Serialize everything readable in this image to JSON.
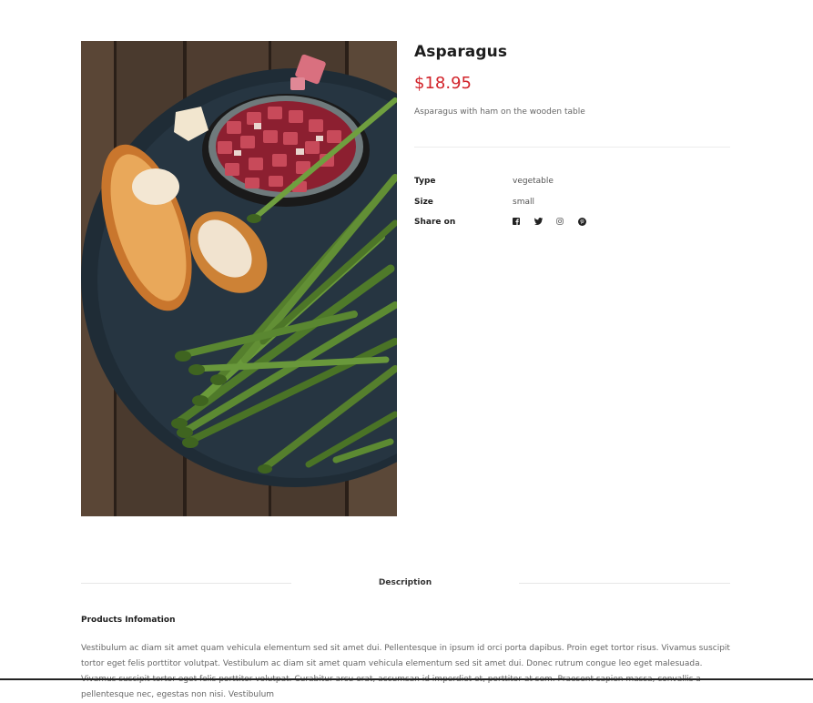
{
  "product": {
    "title": "Asparagus",
    "price": "$18.95",
    "short_description": "Asparagus with ham on the wooden table",
    "meta": [
      {
        "label": "Type",
        "value": "vegetable"
      },
      {
        "label": "Size",
        "value": "small"
      }
    ],
    "share_label": "Share on",
    "share_icons": [
      "facebook-icon",
      "twitter-icon",
      "instagram-icon",
      "pinterest-icon"
    ],
    "image_description": "asparagus-ham-bread-on-slate"
  },
  "tabs": {
    "active": "Description"
  },
  "info": {
    "heading": "Products Infomation",
    "body": "Vestibulum ac diam sit amet quam vehicula elementum sed sit amet dui. Pellentesque in ipsum id orci porta dapibus. Proin eget tortor risus. Vivamus suscipit tortor eget felis porttitor volutpat. Vestibulum ac diam sit amet quam vehicula elementum sed sit amet dui. Donec rutrum congue leo eget malesuada. Vivamus suscipit tortor eget felis porttitor volutpat. Curabitur arcu erat, accumsan id imperdiet et, porttitor at sem. Praesent sapien massa, convallis a pellentesque nec, egestas non nisi. Vestibulum"
  },
  "colors": {
    "price": "#d2232a",
    "text": "#1d1d1d",
    "muted": "#666666"
  }
}
